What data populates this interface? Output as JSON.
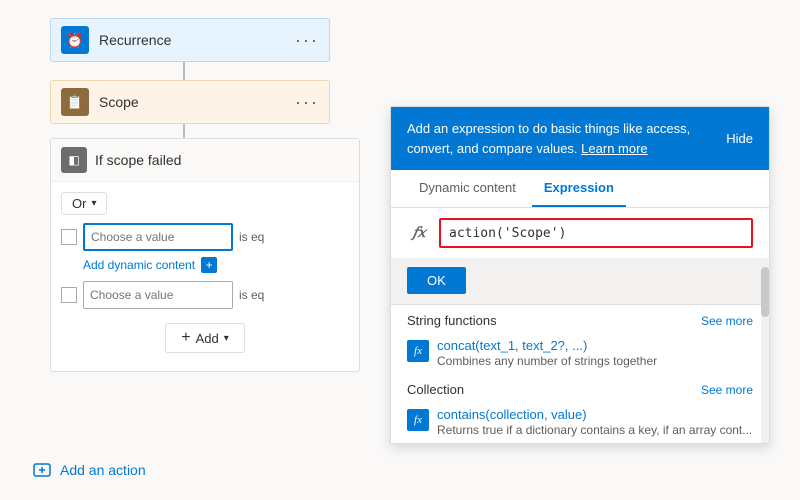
{
  "recurrence": {
    "title": "Recurrence",
    "icon": "⏰"
  },
  "scope": {
    "title": "Scope",
    "icon": "📋"
  },
  "if_scope": {
    "title": "If scope failed",
    "icon": "◧",
    "or_label": "Or",
    "condition1_placeholder": "Choose a value",
    "condition1_operator": "is eq",
    "condition2_placeholder": "Choose a value",
    "condition2_operator": "is eq",
    "add_dynamic_label": "Add dynamic content",
    "add_label": "Add"
  },
  "add_action": {
    "label": "Add an action"
  },
  "expression_panel": {
    "info_text": "Add an expression to do basic things like access, convert, and compare values.",
    "learn_more": "Learn more",
    "hide_label": "Hide",
    "tab_dynamic": "Dynamic content",
    "tab_expression": "Expression",
    "expression_value": "action('Scope')",
    "ok_label": "OK",
    "fx_symbol": "fx",
    "sections": [
      {
        "title": "String functions",
        "see_more": "See more",
        "items": [
          {
            "name": "concat(text_1, text_2?, ...)",
            "desc": "Combines any number of strings together"
          }
        ]
      },
      {
        "title": "Collection",
        "see_more": "See more",
        "items": [
          {
            "name": "contains(collection, value)",
            "desc": "Returns true if a dictionary contains a key, if an array cont..."
          }
        ]
      }
    ]
  }
}
